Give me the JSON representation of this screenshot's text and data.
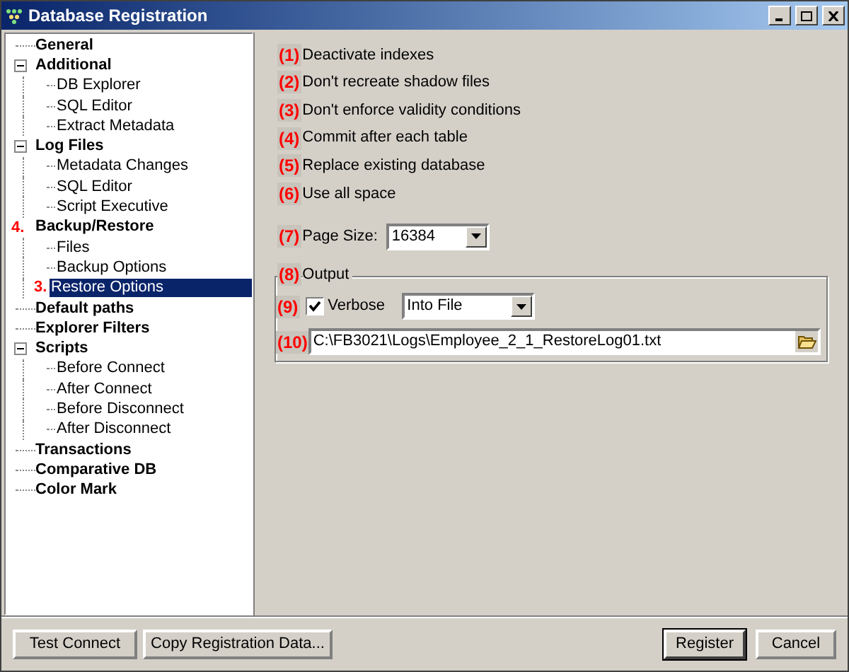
{
  "window": {
    "title": "Database Registration"
  },
  "tree": [
    {
      "label": "General"
    },
    {
      "label": "Additional",
      "expanded": true,
      "children": [
        {
          "label": "DB Explorer",
          "selected": false
        },
        {
          "label": "SQL Editor",
          "selected": false
        },
        {
          "label": "Extract Metadata",
          "selected": false
        }
      ]
    },
    {
      "label": "Log Files",
      "expanded": true,
      "children": [
        {
          "label": "Metadata Changes",
          "selected": false
        },
        {
          "label": "SQL Editor",
          "selected": false
        },
        {
          "label": "Script Executive",
          "selected": false
        }
      ]
    },
    {
      "label": "Backup/Restore",
      "annotation": "4.",
      "children": [
        {
          "label": "Files",
          "selected": false
        },
        {
          "label": "Backup Options",
          "selected": false
        },
        {
          "label": "Restore Options",
          "annotation": "3.",
          "selected": true
        }
      ]
    },
    {
      "label": "Default paths"
    },
    {
      "label": "Explorer Filters"
    },
    {
      "label": "Scripts",
      "expanded": true,
      "children": [
        {
          "label": "Before Connect",
          "selected": false
        },
        {
          "label": "After Connect",
          "selected": false
        },
        {
          "label": "Before Disconnect",
          "selected": false
        },
        {
          "label": "After Disconnect",
          "selected": false
        }
      ]
    },
    {
      "label": "Transactions"
    },
    {
      "label": "Comparative DB"
    },
    {
      "label": "Color Mark"
    }
  ],
  "options": [
    {
      "marker": "(1)",
      "label": "Deactivate indexes"
    },
    {
      "marker": "(2)",
      "label": "Don't recreate shadow files"
    },
    {
      "marker": "(3)",
      "label": "Don't enforce validity conditions"
    },
    {
      "marker": "(4)",
      "label": "Commit after each table"
    },
    {
      "marker": "(5)",
      "label": "Replace existing database"
    },
    {
      "marker": "(6)",
      "label": "Use all space"
    }
  ],
  "page_size": {
    "marker": "(7)",
    "label": "Page Size:",
    "value": "16384"
  },
  "output": {
    "marker": "(8)",
    "legend": "Output",
    "verbose": {
      "marker": "(9)",
      "label": "Verbose",
      "checked": true
    },
    "target": "Into File",
    "path": {
      "marker": "(10)",
      "value": "C:\\FB3021\\Logs\\Employee_2_1_RestoreLog01.txt"
    }
  },
  "buttons_left": [
    "Test Connect",
    "Copy Registration Data..."
  ],
  "buttons_right": [
    {
      "label": "Register",
      "default": true
    },
    {
      "label": "Cancel",
      "default": false
    }
  ]
}
